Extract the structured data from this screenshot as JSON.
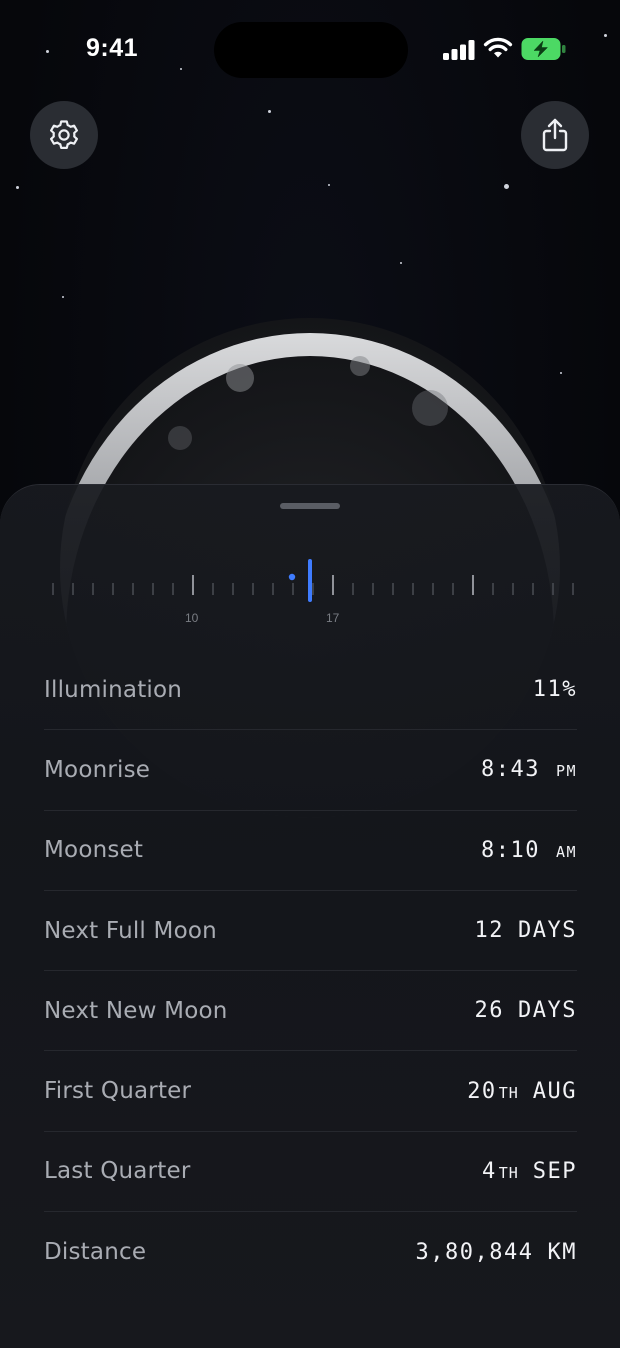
{
  "status_bar": {
    "time": "9:41"
  },
  "buttons": {
    "settings_icon": "gear-icon",
    "share_icon": "share-icon"
  },
  "timeline": {
    "tick_labels": [
      "10",
      "17"
    ],
    "accent_color": "#3f7cff"
  },
  "details": [
    {
      "label": "Illumination",
      "value": "11%",
      "unit": ""
    },
    {
      "label": "Moonrise",
      "value": "8:43",
      "unit": "PM"
    },
    {
      "label": "Moonset",
      "value": "8:10",
      "unit": "AM"
    },
    {
      "label": "Next Full Moon",
      "value": "12",
      "unit": "DAYS"
    },
    {
      "label": "Next New Moon",
      "value": "26",
      "unit": "DAYS"
    },
    {
      "label": "First Quarter",
      "value": "20",
      "suffix": "TH",
      "unit": "AUG"
    },
    {
      "label": "Last Quarter",
      "value": "4",
      "suffix": "TH",
      "unit": "SEP"
    },
    {
      "label": "Distance",
      "value": "3,80,844",
      "unit": "KM"
    }
  ]
}
